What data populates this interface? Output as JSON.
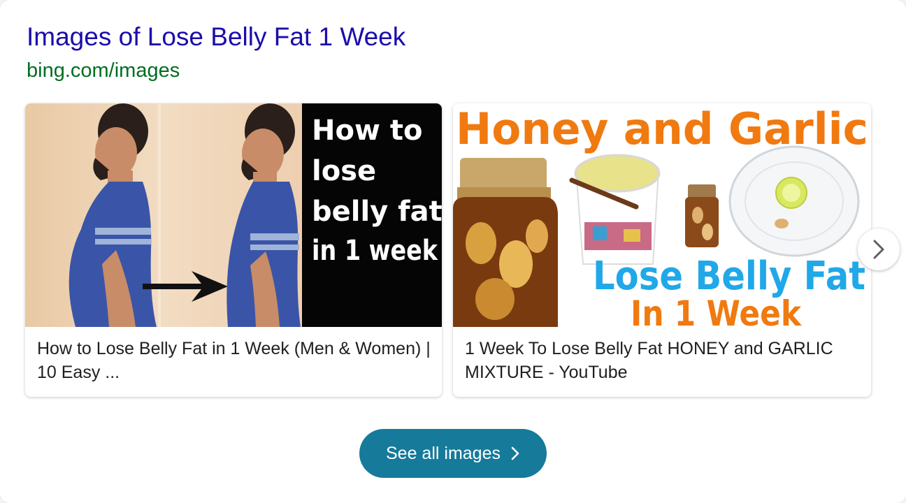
{
  "result": {
    "title": "Images of Lose Belly Fat 1 Week",
    "url": "bing.com/images"
  },
  "cards": [
    {
      "image_text_lines": [
        "How to",
        "lose",
        "belly fat",
        "in 1 week"
      ],
      "caption": "How to Lose Belly Fat in 1 Week (Men & Women) | 10 Easy ..."
    },
    {
      "image_headline": "Honey and Garlic",
      "image_subline_1": "Lose Belly Fat",
      "image_subline_2": "In 1 Week",
      "caption": "1 Week To Lose Belly Fat HONEY and GARLIC MIXTURE - YouTube"
    }
  ],
  "see_all": {
    "label": "See all images"
  },
  "icons": {
    "next": "chevron-right-icon",
    "see_all_chevron": "chevron-right-icon"
  },
  "colors": {
    "title_link": "#1a0dab",
    "url": "#006d21",
    "button": "#167a9a",
    "headline_orange": "#f07a10",
    "subline_blue": "#20a8e8"
  }
}
